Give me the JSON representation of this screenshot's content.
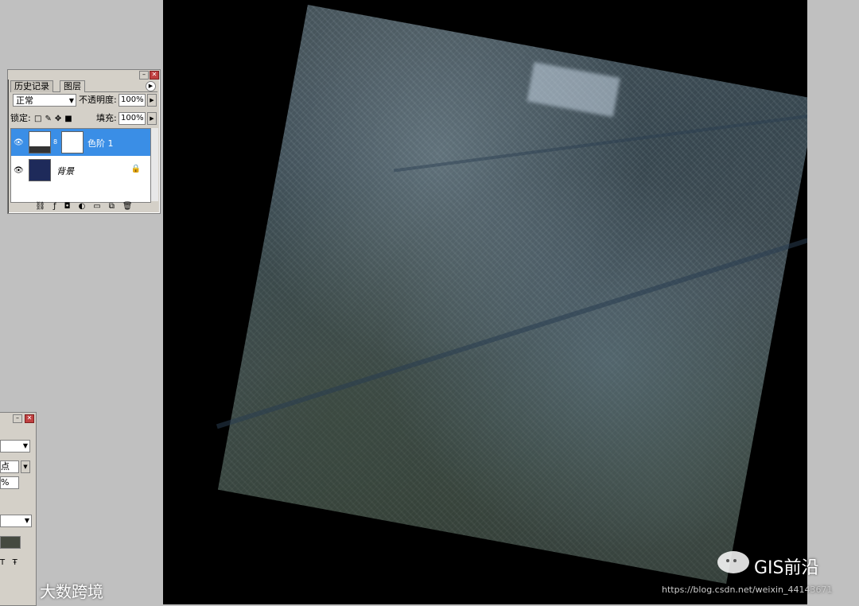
{
  "layers_panel": {
    "tabs": [
      "历史记录",
      "图层"
    ],
    "blend_mode": "正常",
    "opacity_label": "不透明度:",
    "opacity_value": "100%",
    "lock_label": "锁定:",
    "fill_label": "填充:",
    "fill_value": "100%",
    "layers": [
      {
        "name": "色阶 1",
        "selected": true,
        "visible": true
      },
      {
        "name": "背景",
        "selected": false,
        "visible": true,
        "locked": true
      }
    ]
  },
  "second_panel": {
    "unit_text": "点",
    "percent_text": "%"
  },
  "watermarks": {
    "brand_left": "大数跨境",
    "brand_right": "GIS前沿",
    "url": "https://blog.csdn.net/weixin_44143671"
  },
  "colors": {
    "selection": "#3a8ee6",
    "canvas_bg": "#000000",
    "workspace_bg": "#c0c0c0"
  }
}
